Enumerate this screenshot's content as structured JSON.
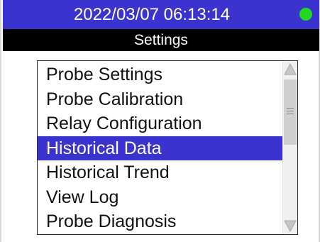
{
  "status_bar": {
    "datetime": "2022/03/07 06:13:14",
    "indicator_color": "#22d822"
  },
  "header": {
    "title": "Settings"
  },
  "menu": {
    "items": [
      {
        "label": "Probe Settings",
        "selected": false
      },
      {
        "label": "Probe Calibration",
        "selected": false
      },
      {
        "label": "Relay Configuration",
        "selected": false
      },
      {
        "label": "Historical Data",
        "selected": true
      },
      {
        "label": "Historical Trend",
        "selected": false
      },
      {
        "label": "View Log",
        "selected": false
      },
      {
        "label": "Probe Diagnosis",
        "selected": false
      }
    ]
  },
  "colors": {
    "accent": "#3a33cf",
    "title_bar": "#000000"
  }
}
